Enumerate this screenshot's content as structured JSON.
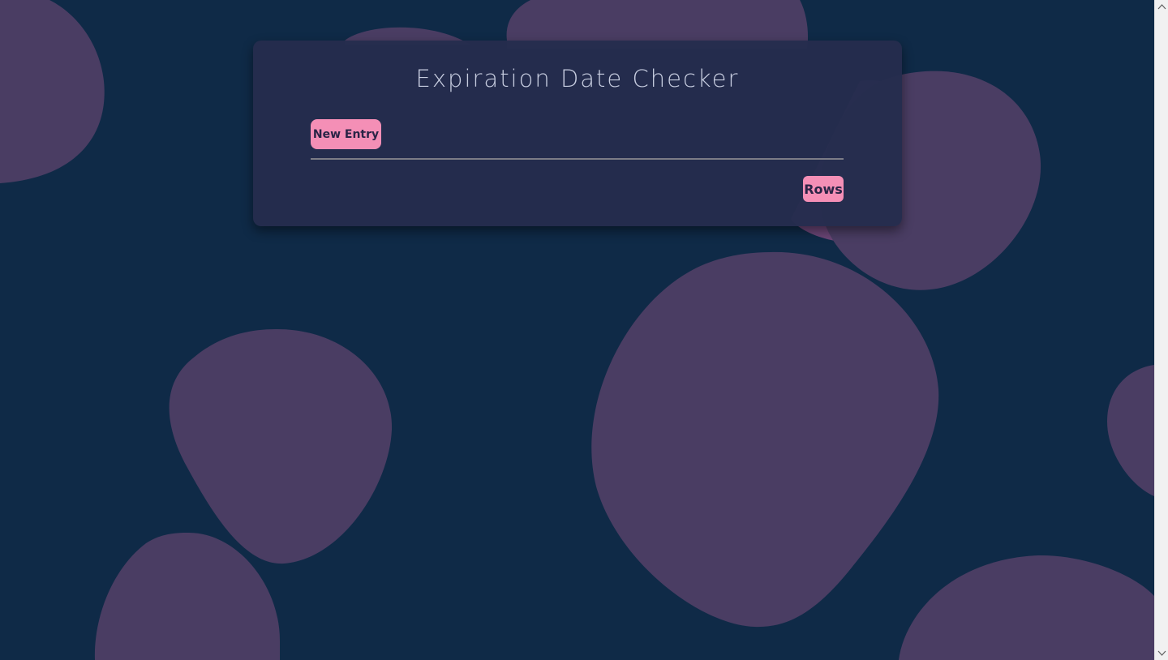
{
  "app": {
    "title": "Expiration Date Checker"
  },
  "actions": {
    "new_entry_label": "New Entry",
    "rows_label": "Rows"
  },
  "colors": {
    "background": "#0f2a47",
    "blob": "#4a3d63",
    "card": "#252c4d",
    "accent_button": "#f48fb6",
    "button_text": "#2a2446",
    "title_text": "#c7cde0"
  }
}
